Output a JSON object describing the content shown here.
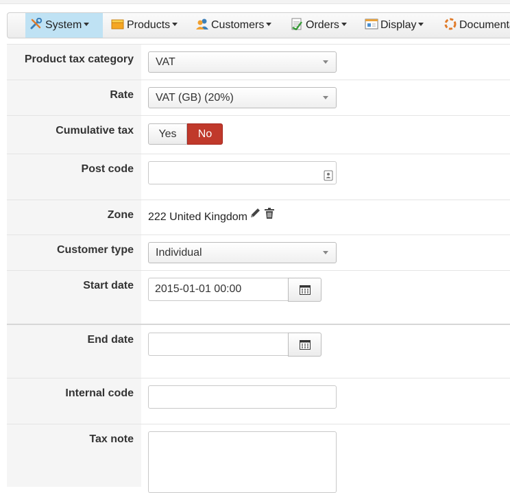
{
  "menu": {
    "items": [
      {
        "label": "System",
        "icon": "tools-icon",
        "active": true
      },
      {
        "label": "Products",
        "icon": "box-icon"
      },
      {
        "label": "Customers",
        "icon": "users-icon"
      },
      {
        "label": "Orders",
        "icon": "orders-icon"
      },
      {
        "label": "Display",
        "icon": "display-icon"
      },
      {
        "label": "Documenta",
        "icon": "lifebuoy-icon"
      }
    ]
  },
  "form": {
    "product_tax_category": {
      "label": "Product tax category",
      "value": "VAT"
    },
    "rate": {
      "label": "Rate",
      "value": "VAT (GB) (20%)"
    },
    "cumulative_tax": {
      "label": "Cumulative tax",
      "yes": "Yes",
      "no": "No",
      "selected": "No"
    },
    "post_code": {
      "label": "Post code",
      "value": ""
    },
    "zone": {
      "label": "Zone",
      "value": "222 United Kingdom"
    },
    "customer_type": {
      "label": "Customer type",
      "value": "Individual"
    },
    "start_date": {
      "label": "Start date",
      "value": "2015-01-01 00:00"
    },
    "end_date": {
      "label": "End date",
      "value": ""
    },
    "internal_code": {
      "label": "Internal code",
      "value": ""
    },
    "tax_note": {
      "label": "Tax note",
      "value": ""
    }
  },
  "colors": {
    "active_menu": "#bfe2f4",
    "toggle_no": "#c0392b",
    "label_bg": "#f5f5f5"
  }
}
